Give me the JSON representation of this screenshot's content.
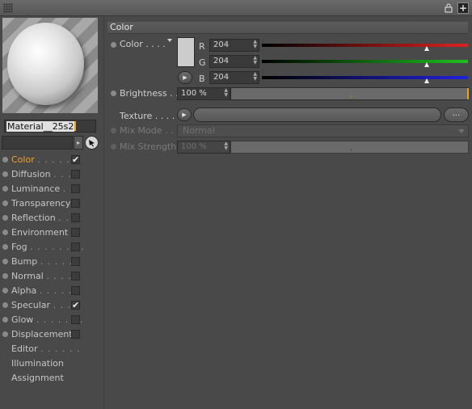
{
  "toolbar": {
    "grip_icon": "grip-icon",
    "lock_icon": "lock-icon",
    "add_icon": "add-icon",
    "add_label": "+"
  },
  "material": {
    "name": "Material__25s2",
    "preview_icon": "material-sphere-preview"
  },
  "channels": [
    {
      "label": "Color",
      "dots": ". . . . . .",
      "has_checkbox": true,
      "checked": true,
      "active": true
    },
    {
      "label": "Diffusion",
      "dots": ". . . .",
      "has_checkbox": true,
      "checked": false,
      "active": false
    },
    {
      "label": "Luminance",
      "dots": ". .",
      "has_checkbox": true,
      "checked": false,
      "active": false
    },
    {
      "label": "Transparency",
      "dots": "",
      "has_checkbox": true,
      "checked": false,
      "active": false
    },
    {
      "label": "Reflection",
      "dots": ". .",
      "has_checkbox": true,
      "checked": false,
      "active": false
    },
    {
      "label": "Environment",
      "dots": "",
      "has_checkbox": true,
      "checked": false,
      "active": false
    },
    {
      "label": "Fog",
      "dots": ". . . . . . . .",
      "has_checkbox": true,
      "checked": false,
      "active": false
    },
    {
      "label": "Bump",
      "dots": ". . . . . .",
      "has_checkbox": true,
      "checked": false,
      "active": false
    },
    {
      "label": "Normal",
      "dots": ". . . .",
      "has_checkbox": true,
      "checked": false,
      "active": false
    },
    {
      "label": "Alpha",
      "dots": ". . . . . .",
      "has_checkbox": true,
      "checked": false,
      "active": false
    },
    {
      "label": "Specular",
      "dots": ". . . .",
      "has_checkbox": true,
      "checked": true,
      "active": false
    },
    {
      "label": "Glow",
      "dots": ". . . . . . .",
      "has_checkbox": true,
      "checked": false,
      "active": false
    },
    {
      "label": "Displacement",
      "dots": "",
      "has_checkbox": true,
      "checked": false,
      "active": false
    },
    {
      "label": "Editor",
      "dots": ". . . . . .",
      "has_checkbox": false,
      "checked": false,
      "active": false
    },
    {
      "label": "Illumination",
      "dots": "",
      "has_checkbox": false,
      "checked": false,
      "active": false
    },
    {
      "label": "Assignment",
      "dots": "",
      "has_checkbox": false,
      "checked": false,
      "active": false
    }
  ],
  "section": {
    "title": "Color"
  },
  "color": {
    "label": "Color",
    "dots": ". . . .",
    "swatch_hex": "#cccccc",
    "r_label": "R",
    "g_label": "G",
    "b_label": "B",
    "r_value": "204",
    "g_value": "204",
    "b_value": "204",
    "r_fraction": 0.8,
    "g_fraction": 0.8,
    "b_fraction": 0.8,
    "r_color": "#e02020",
    "g_color": "#20c020",
    "b_color": "#2020e0"
  },
  "brightness": {
    "label": "Brightness",
    "dots": ". .",
    "value": "100 %"
  },
  "texture": {
    "label": "Texture",
    "dots": ". . . . .",
    "more_label": "..."
  },
  "mix_mode": {
    "label": "Mix Mode",
    "dots": ". . .",
    "value": "Normal"
  },
  "mix_strength": {
    "label": "Mix Strength",
    "value": "100 %"
  },
  "colors": {
    "accent": "#f0a020",
    "background": "#494949"
  }
}
